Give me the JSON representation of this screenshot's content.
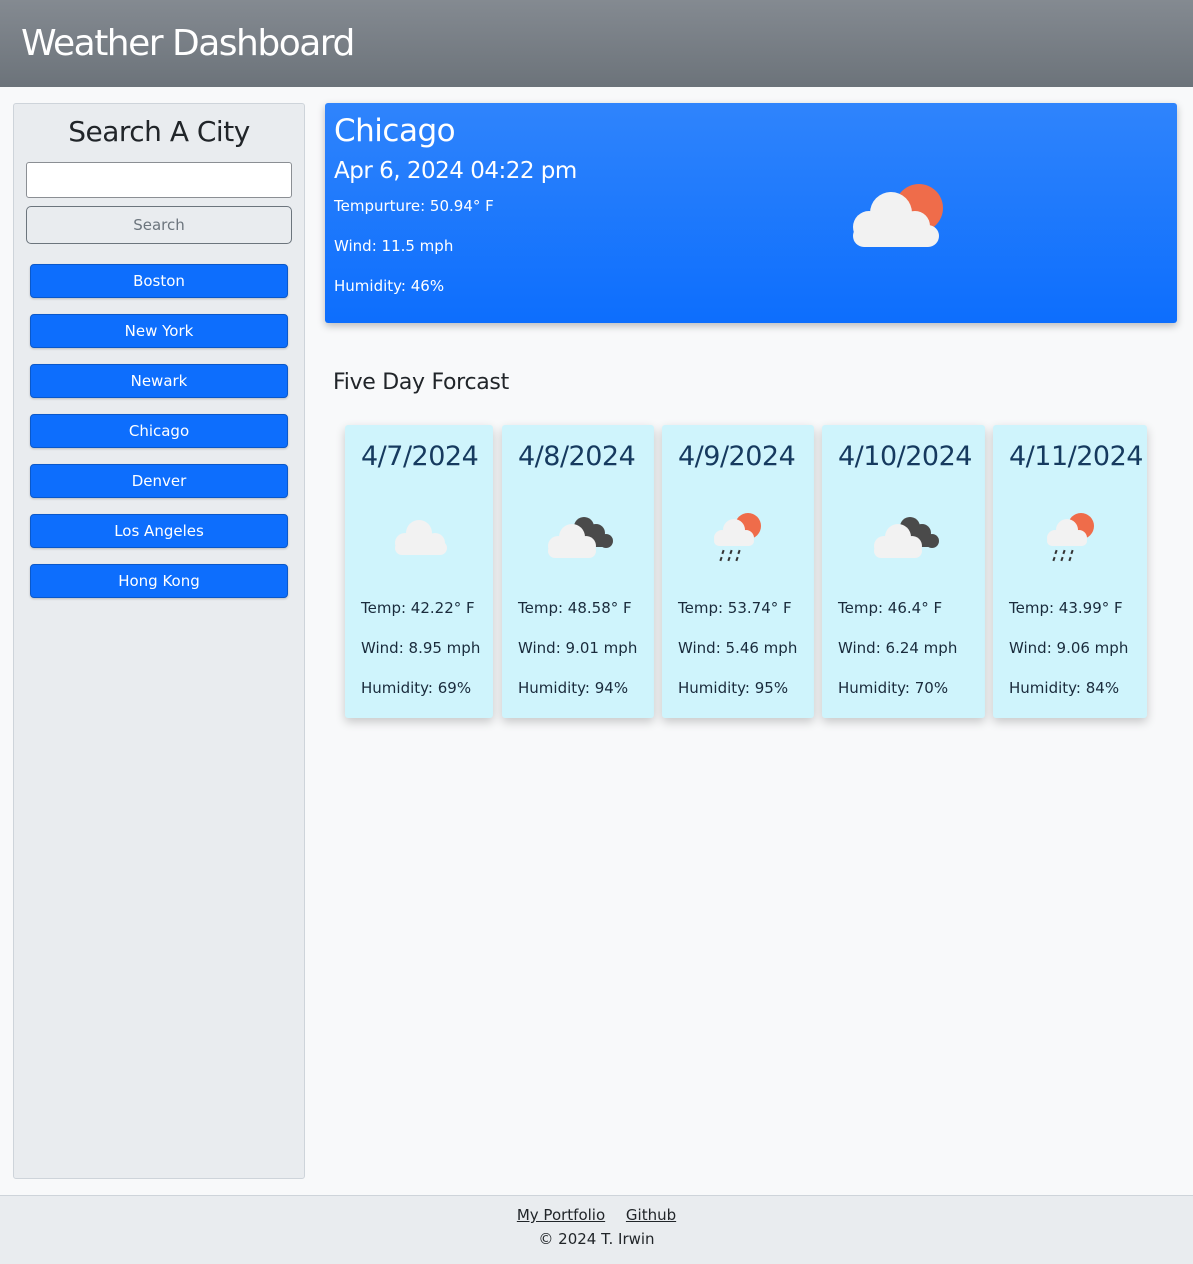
{
  "header": {
    "title": "Weather Dashboard"
  },
  "sidebar": {
    "title": "Search A City",
    "search_value": "",
    "search_label": "Search",
    "history": [
      "Boston",
      "New York",
      "Newark",
      "Chicago",
      "Denver",
      "Los Angeles",
      "Hong Kong"
    ]
  },
  "current": {
    "city": "Chicago",
    "datetime": "Apr 6, 2024 04:22 pm",
    "temp": "Tempurture: 50.94° F",
    "wind": "Wind: 11.5 mph",
    "humidity": "Humidity: 46%",
    "icon": "partly-cloudy-icon"
  },
  "forecast": {
    "title": "Five Day Forcast",
    "days": [
      {
        "date": "4/7/2024",
        "icon": "cloud-icon",
        "temp": "Temp: 42.22° F",
        "wind": "Wind: 8.95 mph",
        "humidity": "Humidity: 69%"
      },
      {
        "date": "4/8/2024",
        "icon": "broken-clouds-icon",
        "temp": "Temp: 48.58° F",
        "wind": "Wind: 9.01 mph",
        "humidity": "Humidity: 94%"
      },
      {
        "date": "4/9/2024",
        "icon": "rain-sun-icon",
        "temp": "Temp: 53.74° F",
        "wind": "Wind: 5.46 mph",
        "humidity": "Humidity: 95%"
      },
      {
        "date": "4/10/2024",
        "icon": "broken-clouds-icon",
        "temp": "Temp: 46.4° F",
        "wind": "Wind: 6.24 mph",
        "humidity": "Humidity: 70%"
      },
      {
        "date": "4/11/2024",
        "icon": "rain-sun-icon",
        "temp": "Temp: 43.99° F",
        "wind": "Wind: 9.06 mph",
        "humidity": "Humidity: 84%"
      }
    ]
  },
  "footer": {
    "links": [
      "My Portfolio",
      "Github"
    ],
    "copyright": "© 2024 T. Irwin"
  },
  "colors": {
    "accent": "#0d6efd",
    "card_bg": "#cff4fc",
    "sun": "#ef6c4a"
  }
}
